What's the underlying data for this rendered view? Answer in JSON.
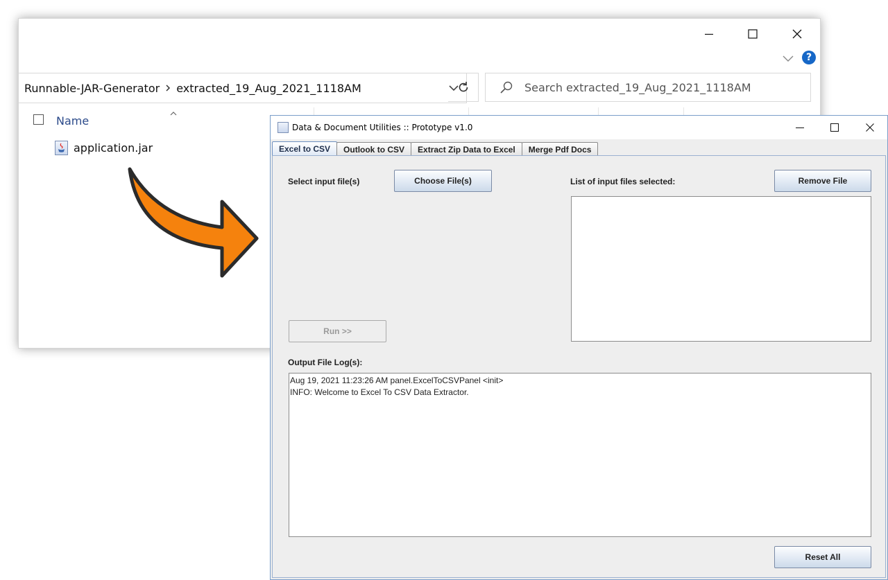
{
  "explorer": {
    "breadcrumb": [
      "Runnable-JAR-Generator",
      "extracted_19_Aug_2021_1118AM"
    ],
    "search_placeholder": "Search extracted_19_Aug_2021_1118AM",
    "column_name": "Name",
    "files": [
      {
        "name": "application.jar",
        "icon": "jar-file-icon"
      }
    ],
    "help_label": "?"
  },
  "app": {
    "title": "Data & Document Utilities :: Prototype v1.0",
    "tabs": [
      {
        "label": "Excel to CSV",
        "active": true
      },
      {
        "label": "Outlook to CSV",
        "active": false
      },
      {
        "label": "Extract Zip Data to Excel",
        "active": false
      },
      {
        "label": "Merge Pdf Docs",
        "active": false
      }
    ],
    "select_input_label": "Select input file(s)",
    "choose_files_button": "Choose File(s)",
    "list_label": "List of input files selected:",
    "remove_file_button": "Remove File",
    "run_button": "Run >>",
    "output_log_label": "Output File Log(s):",
    "log_lines": [
      "Aug 19, 2021 11:23:26 AM panel.ExcelToCSVPanel <init>",
      "INFO: Welcome to Excel To CSV Data Extractor."
    ],
    "reset_all_button": "Reset All"
  },
  "colors": {
    "arrow_fill": "#f5820d",
    "help_badge": "#1667c7",
    "active_tab": "#dfe8f5"
  }
}
